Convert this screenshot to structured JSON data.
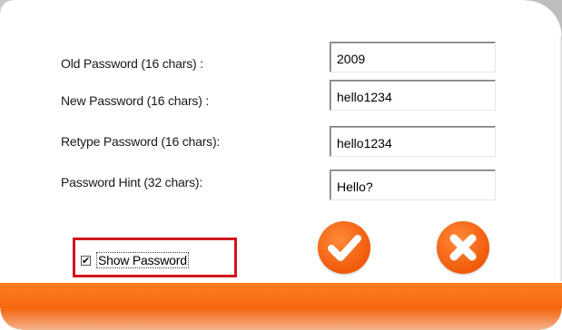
{
  "form": {
    "old_password": {
      "label": "Old Password (16 chars) :",
      "value": "2009"
    },
    "new_password": {
      "label": "New Password (16 chars) :",
      "value": "hello1234"
    },
    "retype_password": {
      "label": "Retype Password (16 chars):",
      "value": "hello1234"
    },
    "password_hint": {
      "label": "Password Hint (32 chars):",
      "value": "Hello?"
    }
  },
  "show_password": {
    "label": "Show Password",
    "checked": true,
    "check_glyph": "✔"
  },
  "buttons": {
    "ok_icon": "checkmark-icon",
    "cancel_icon": "x-icon"
  },
  "colors": {
    "accent": "#f5650e",
    "highlight_border": "#d0151c"
  }
}
